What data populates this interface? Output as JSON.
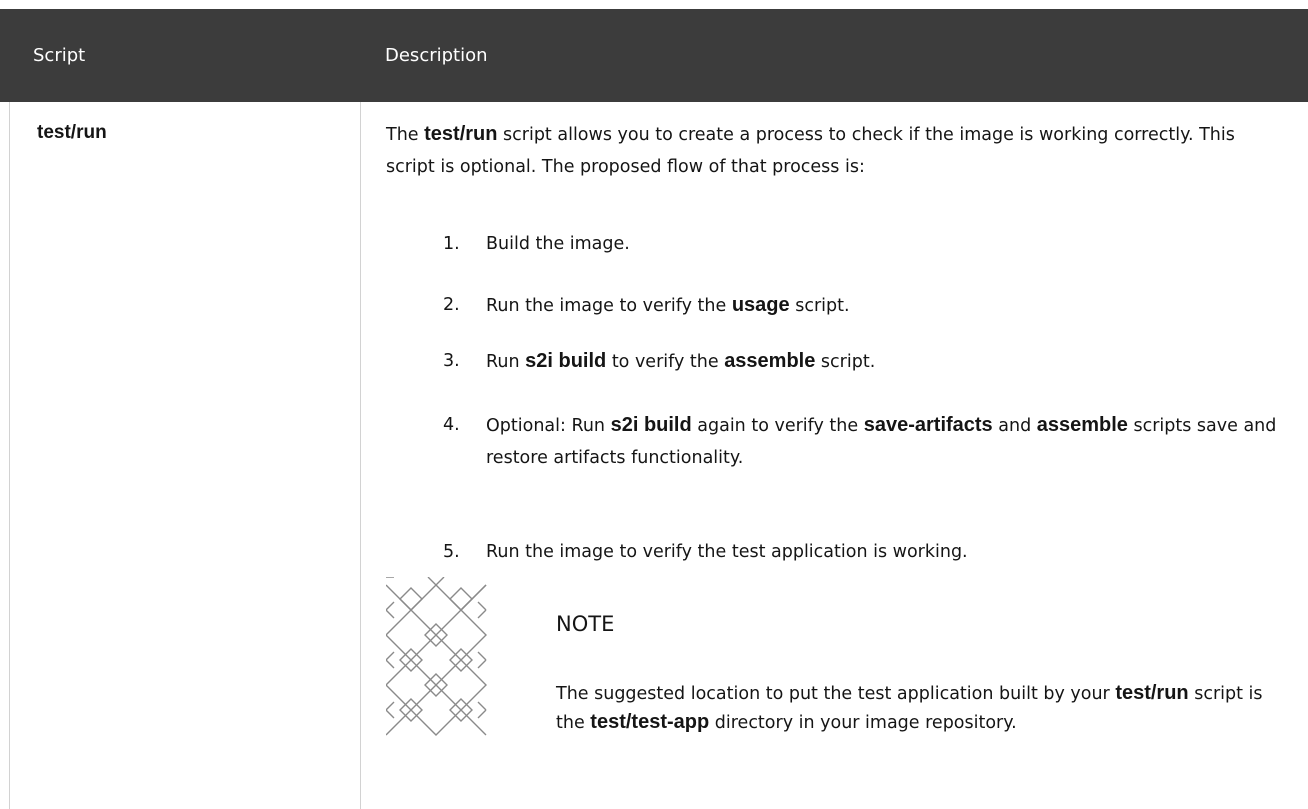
{
  "table": {
    "headers": {
      "script": "Script",
      "description": "Description"
    },
    "row": {
      "script_name": "test/run",
      "intro": {
        "pre": "The ",
        "code": "test/run",
        "post": " script allows you to create a process to check if the image is working correctly. This script is optional. The proposed flow of that process is:"
      },
      "steps": [
        {
          "num": "1.",
          "parts": [
            {
              "t": "Build the image.",
              "code": false
            }
          ]
        },
        {
          "num": "2.",
          "parts": [
            {
              "t": "Run the image to verify the ",
              "code": false
            },
            {
              "t": "usage",
              "code": true
            },
            {
              "t": " script.",
              "code": false
            }
          ]
        },
        {
          "num": "3.",
          "parts": [
            {
              "t": "Run ",
              "code": false
            },
            {
              "t": "s2i build",
              "code": true
            },
            {
              "t": " to verify the ",
              "code": false
            },
            {
              "t": "assemble",
              "code": true
            },
            {
              "t": " script.",
              "code": false
            }
          ]
        },
        {
          "num": "4.",
          "parts": [
            {
              "t": "Optional: Run ",
              "code": false
            },
            {
              "t": "s2i build",
              "code": true
            },
            {
              "t": " again to verify the ",
              "code": false
            },
            {
              "t": "save-artifacts",
              "code": true
            },
            {
              "t": " and ",
              "code": false
            },
            {
              "t": "assemble",
              "code": true
            },
            {
              "t": " scripts save and restore artifacts functionality.",
              "code": false
            }
          ]
        },
        {
          "num": "5.",
          "parts": [
            {
              "t": "Run the image to verify the test application is working.",
              "code": false
            }
          ]
        }
      ],
      "note": {
        "icon": "note-pattern-icon",
        "title": "NOTE",
        "body_parts": [
          {
            "t": "The suggested location to put the test application built by your ",
            "code": false
          },
          {
            "t": "test/run",
            "code": true
          },
          {
            "t": " script is the ",
            "code": false
          },
          {
            "t": "test/test-app",
            "code": true
          },
          {
            "t": " directory in your image repository.",
            "code": false
          }
        ]
      }
    }
  },
  "colors": {
    "header_bg": "#3c3c3c",
    "header_text": "#ffffff",
    "body_text": "#151515",
    "divider": "#d2d2d2",
    "icon_stroke": "#8a8a8a"
  }
}
